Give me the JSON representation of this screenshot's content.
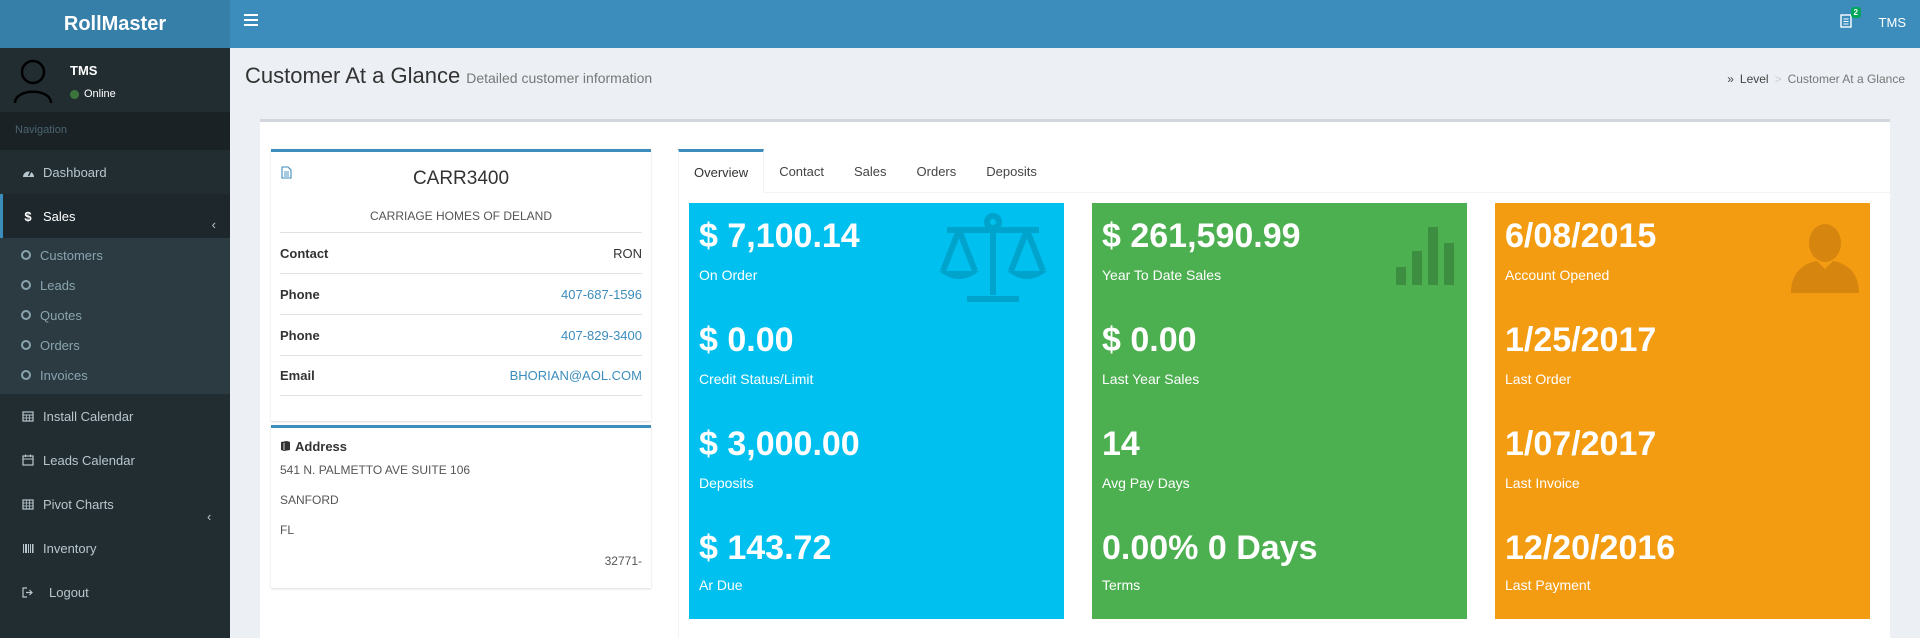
{
  "app": {
    "title": "RollMaster"
  },
  "topbar": {
    "notification_count": "2",
    "user": "TMS"
  },
  "sidebar": {
    "user_name": "TMS",
    "user_status": "Online",
    "nav_header": "Navigation",
    "items": [
      {
        "label": "Dashboard",
        "icon": "dashboard-icon"
      },
      {
        "label": "Sales",
        "icon": "dollar-icon"
      },
      {
        "label": "Install Calendar",
        "icon": "calendar-icon"
      },
      {
        "label": "Leads Calendar",
        "icon": "calendar-icon"
      },
      {
        "label": "Pivot Charts",
        "icon": "table-icon"
      },
      {
        "label": "Inventory",
        "icon": "barcode-icon"
      },
      {
        "label": "Logout",
        "icon": "sign-out-icon"
      }
    ],
    "sales_sub": [
      "Customers",
      "Leads",
      "Quotes",
      "Orders",
      "Invoices"
    ]
  },
  "header": {
    "title": "Customer At a Glance",
    "subtitle": "Detailed customer information",
    "breadcrumb": [
      "Level",
      "Customer At a Glance"
    ]
  },
  "customer": {
    "code": "CARR3400",
    "name": "CARRIAGE HOMES OF DELAND",
    "rows": [
      {
        "label": "Contact",
        "value": "RON"
      },
      {
        "label": "Phone",
        "value": "407-687-1596"
      },
      {
        "label": "Phone",
        "value": "407-829-3400"
      },
      {
        "label": "Email",
        "value": "BHORIAN@AOL.COM"
      }
    ]
  },
  "address": {
    "title": "Address",
    "line1": "541 N. PALMETTO AVE SUITE 106",
    "city": "SANFORD",
    "state": "FL",
    "zip": "32771-"
  },
  "tabs": [
    "Overview",
    "Contact",
    "Sales",
    "Orders",
    "Deposits"
  ],
  "stats": {
    "blue": [
      {
        "value": "$ 7,100.14",
        "label": "On Order"
      },
      {
        "value": "$ 0.00",
        "label": "Credit Status/Limit"
      },
      {
        "value": "$ 3,000.00",
        "label": "Deposits"
      },
      {
        "value": "$ 143.72",
        "label": "Ar Due"
      }
    ],
    "green": [
      {
        "value": "$ 261,590.99",
        "label": "Year To Date Sales"
      },
      {
        "value": "$ 0.00",
        "label": "Last Year Sales"
      },
      {
        "value": "14",
        "label": "Avg Pay Days"
      },
      {
        "value": "0.00% 0 Days",
        "label": "Terms"
      }
    ],
    "orange": [
      {
        "value": "6/08/2015",
        "label": "Account Opened"
      },
      {
        "value": "1/25/2017",
        "label": "Last Order"
      },
      {
        "value": "1/07/2017",
        "label": "Last Invoice"
      },
      {
        "value": "12/20/2016",
        "label": "Last Payment"
      }
    ]
  },
  "colors": {
    "header": "#3c8dbc",
    "logo": "#367fa9",
    "sidebar": "#222d32",
    "blue_box": "#00c0ef",
    "green_box": "#4caf50",
    "orange_box": "#f39c12"
  }
}
